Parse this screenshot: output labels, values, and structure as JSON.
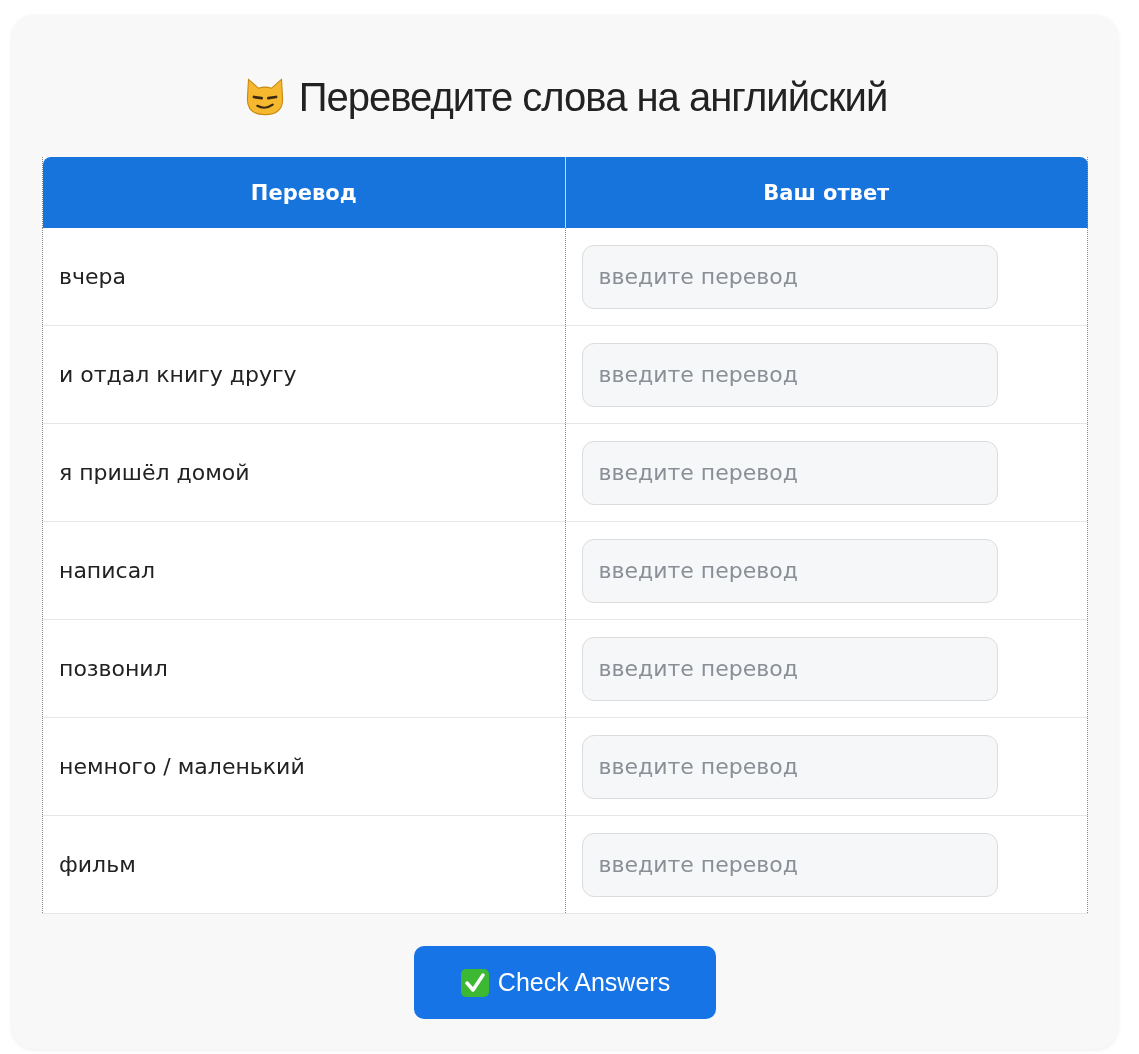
{
  "title": "Переведите слова на английский",
  "table": {
    "columns": [
      "Перевод",
      "Ваш ответ"
    ],
    "rows": [
      {
        "word": "вчера",
        "answer": {
          "placeholder": "введите перевод"
        }
      },
      {
        "word": "и отдал книгу другу",
        "answer": {
          "placeholder": "введите перевод"
        }
      },
      {
        "word": "я пришёл домой",
        "answer": {
          "placeholder": "введите перевод"
        }
      },
      {
        "word": "написал",
        "answer": {
          "placeholder": "введите перевод"
        }
      },
      {
        "word": "позвонил",
        "answer": {
          "placeholder": "введите перевод"
        }
      },
      {
        "word": "немного / маленький",
        "answer": {
          "placeholder": "введите перевод"
        }
      },
      {
        "word": "фильм",
        "answer": {
          "placeholder": "введите перевод"
        }
      }
    ]
  },
  "button": {
    "label": "Check Answers"
  }
}
